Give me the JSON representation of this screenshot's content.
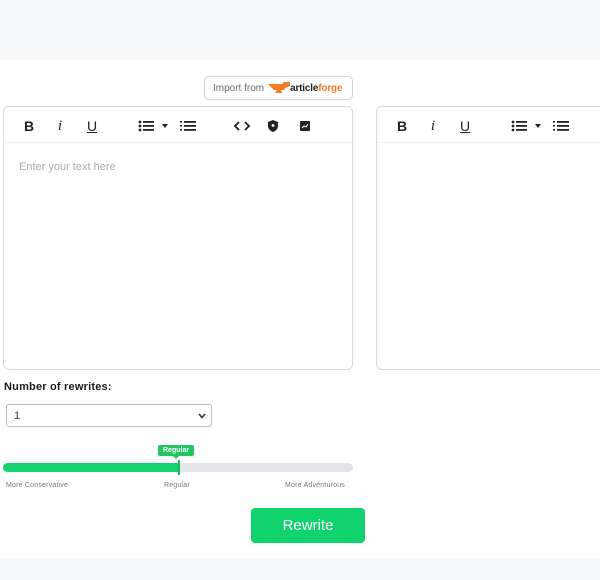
{
  "import": {
    "label": "Import from",
    "brand_part1": "article",
    "brand_part2": "forge"
  },
  "editor_left": {
    "placeholder": "Enter your text here",
    "tools": {
      "bold": "B",
      "italic": "i",
      "underline": "U"
    }
  },
  "editor_right": {
    "tools": {
      "bold": "B",
      "italic": "i",
      "underline": "U"
    }
  },
  "rewrites": {
    "label": "Number of rewrites:",
    "selected": "1"
  },
  "slider": {
    "tooltip": "Regular",
    "value_fraction": 0.5,
    "left_label": "More Conservative",
    "mid_label": "Regular",
    "right_label": "More Adventurous"
  },
  "action": {
    "label": "Rewrite"
  },
  "colors": {
    "accent": "#16d16f",
    "brand_orange": "#f47b20"
  }
}
